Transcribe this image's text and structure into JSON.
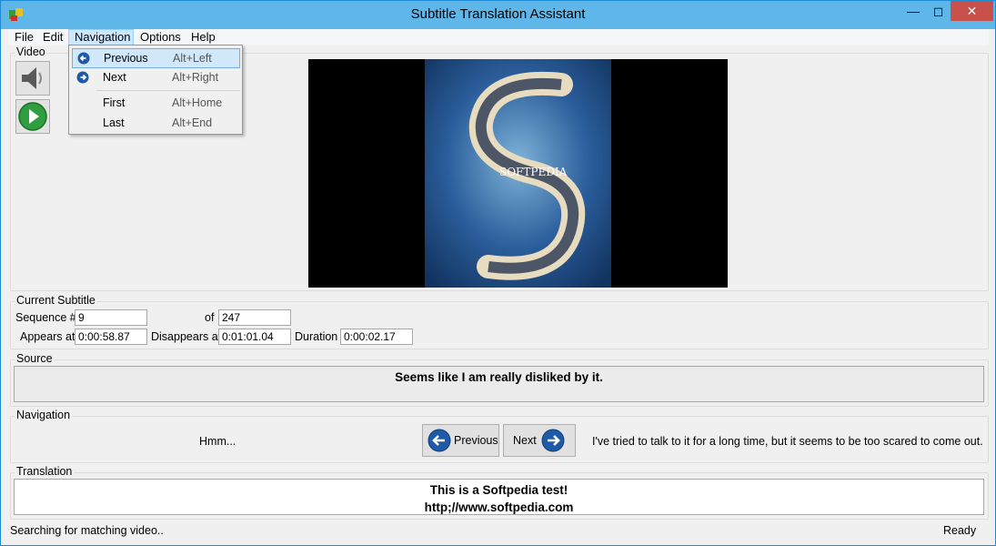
{
  "window": {
    "title": "Subtitle Translation Assistant"
  },
  "titlebar": {
    "minimize": "—",
    "maximize": "◻",
    "close": "✕"
  },
  "menubar": {
    "items": [
      "File",
      "Edit",
      "Navigation",
      "Options",
      "Help"
    ],
    "active": "Navigation"
  },
  "navigation_menu": {
    "items": [
      {
        "label": "Previous",
        "shortcut": "Alt+Left",
        "icon": "arrow-left-circle-icon"
      },
      {
        "label": "Next",
        "shortcut": "Alt+Right",
        "icon": "arrow-right-circle-icon"
      },
      {
        "label": "First",
        "shortcut": "Alt+Home"
      },
      {
        "label": "Last",
        "shortcut": "Alt+End"
      }
    ]
  },
  "video": {
    "group_label": "Video",
    "mute_icon": "speaker-icon",
    "play_icon": "play-icon",
    "frame_text": "SOFTPEDIA",
    "watermark": "SOFTPEDIA"
  },
  "current_subtitle": {
    "group_label": "Current Subtitle",
    "sequence_label": "Sequence #",
    "sequence": "9",
    "of_label": "of",
    "total": "247",
    "appears_label": "Appears at",
    "appears": "0:00:58.87",
    "disappears_label": "Disappears at",
    "disappears": "0:01:01.04",
    "duration_label": "Duration",
    "duration": "0:00:02.17"
  },
  "source": {
    "group_label": "Source",
    "text": "Seems like I am really disliked by it."
  },
  "navigation": {
    "group_label": "Navigation",
    "previous_text": "Hmm...",
    "previous_button": "Previous",
    "next_button": "Next",
    "next_text": "I've tried to talk to it for a long time, but it seems to be too scared to come out."
  },
  "translation": {
    "group_label": "Translation",
    "line1": "This is a Softpedia test!",
    "line2": "http;//www.softpedia.com"
  },
  "status": {
    "left": "Searching for matching video..",
    "right": "Ready"
  },
  "colors": {
    "titlebar": "#5fb6e8",
    "close_button": "#c7504b",
    "accent_blue": "#1e5aa8",
    "play_green": "#2e9e3e"
  }
}
